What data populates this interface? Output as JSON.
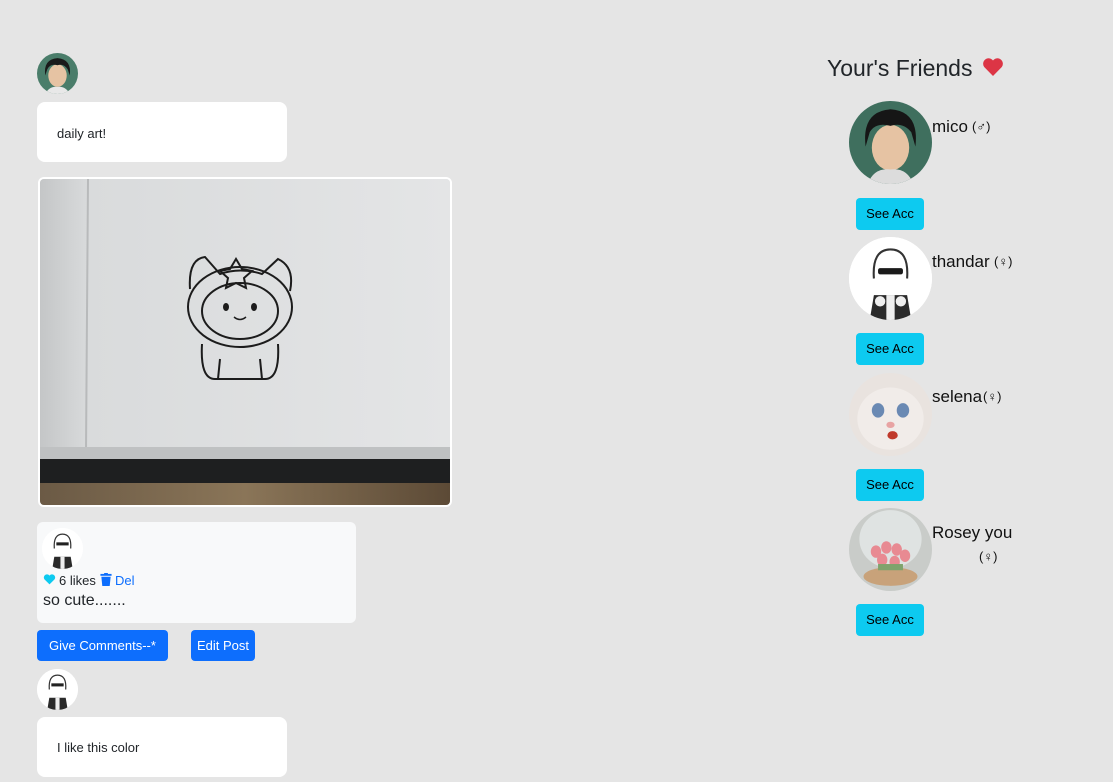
{
  "post": {
    "caption": "daily art!"
  },
  "comment_card": {
    "likes_text": "6 likes",
    "delete_label": "Del",
    "text": "so cute......."
  },
  "actions": {
    "give_comments_label": "Give Comments--*",
    "edit_post_label": "Edit Post"
  },
  "second_post": {
    "caption": "I like this color"
  },
  "friends": {
    "title": "Your's Friends",
    "see_account_label": "See Acc",
    "items": [
      {
        "name": "mico",
        "gender": "(♂)"
      },
      {
        "name": "thandar",
        "gender": "(♀)"
      },
      {
        "name": "selena",
        "gender": "(♀)"
      },
      {
        "name": "Rosey you",
        "gender": "(♀)"
      }
    ]
  },
  "colors": {
    "background": "#e5e5e5",
    "primary": "#0d6efd",
    "info": "#0dcaf0",
    "heart": "#dc3545",
    "like_heart": "#0dcaf0"
  }
}
